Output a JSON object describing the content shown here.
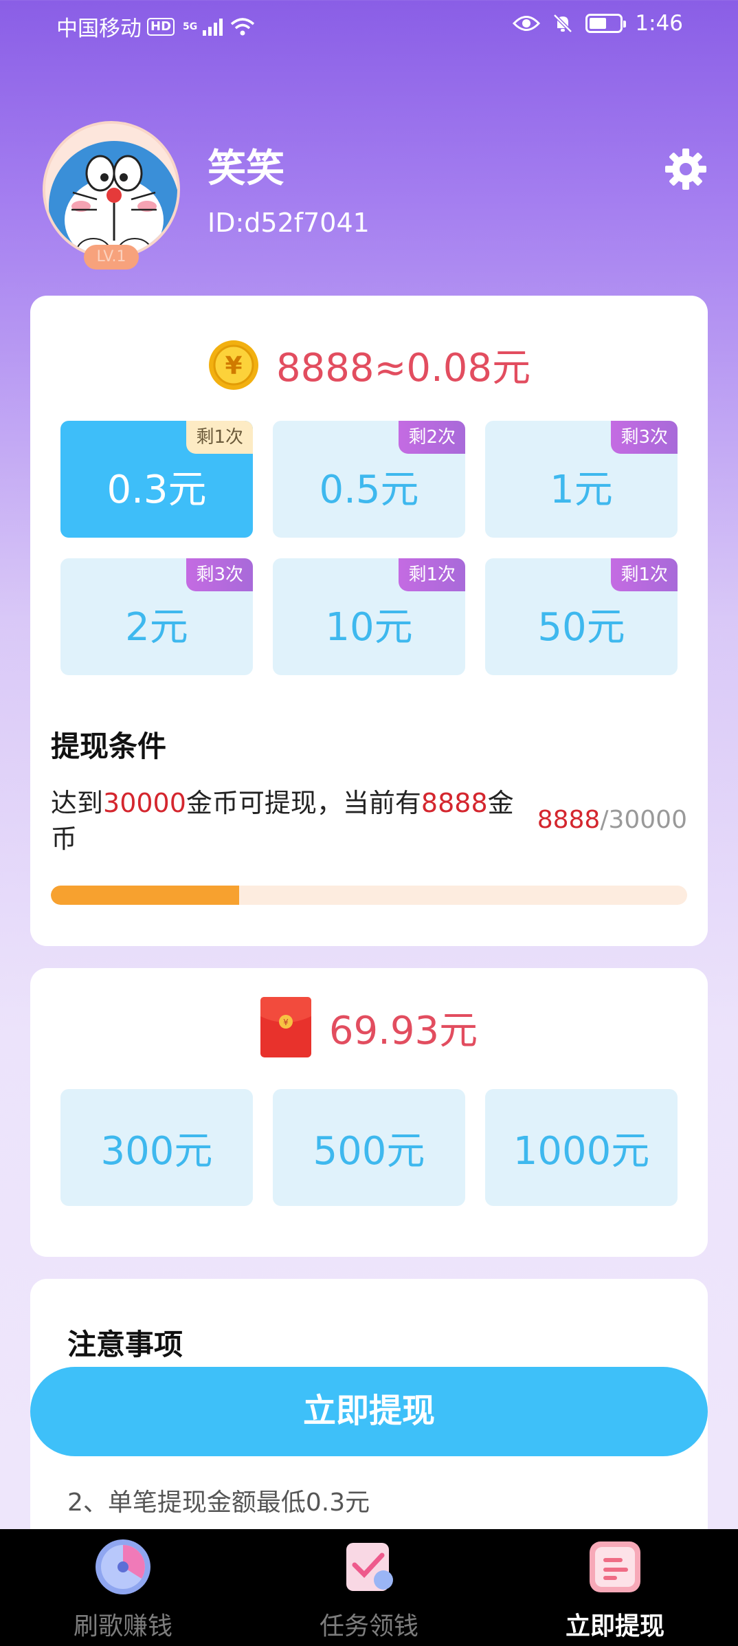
{
  "status_bar": {
    "carrier": "中国移动",
    "hd": "HD",
    "network": "5G",
    "time": "1:46"
  },
  "profile": {
    "name": "笑笑",
    "id": "ID:d52f7041",
    "level": "LV.1"
  },
  "coins": {
    "amount_text": "8888≈0.08元",
    "options": [
      {
        "label": "0.3元",
        "tag": "剩1次"
      },
      {
        "label": "0.5元",
        "tag": "剩2次"
      },
      {
        "label": "1元",
        "tag": "剩3次"
      },
      {
        "label": "2元",
        "tag": "剩3次"
      },
      {
        "label": "10元",
        "tag": "剩1次"
      },
      {
        "label": "50元",
        "tag": "剩1次"
      }
    ],
    "selected_index": 0
  },
  "condition": {
    "title": "提现条件",
    "text_part1": "达到",
    "required": "30000",
    "text_part2": "金币可提现，当前有",
    "current": "8888",
    "text_part3": "金币",
    "count_current": "8888",
    "count_total": "/30000",
    "progress_fraction": 0.296
  },
  "red_packet": {
    "amount_text": "69.93元",
    "options": [
      "300元",
      "500元",
      "1000元"
    ]
  },
  "notice": {
    "title": "注意事项",
    "item2": "2、单笔提现金额最低0.3元"
  },
  "withdraw_button": "立即提现",
  "bottom_nav": [
    {
      "label": "刷歌赚钱"
    },
    {
      "label": "任务领钱"
    },
    {
      "label": "立即提现"
    }
  ],
  "colors": {
    "accent_blue": "#3ec0f9",
    "amount_red": "#e24d5f",
    "progress_orange": "#f7a12f"
  }
}
